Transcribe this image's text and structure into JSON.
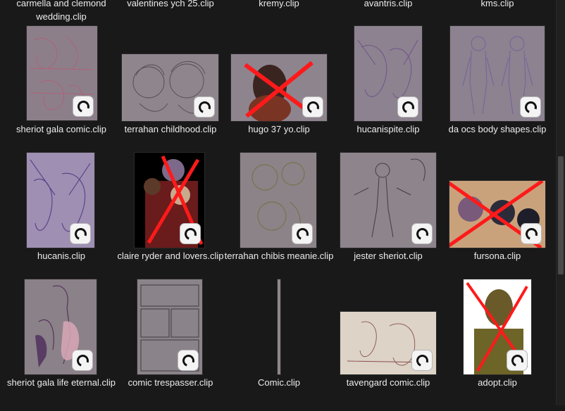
{
  "top_row_labels": [
    "carmella and clemond wedding.clip",
    "valentines ych 25.clip",
    "kremy.clip",
    "avantris.clip",
    "kms.clip"
  ],
  "files": [
    {
      "name": "sheriot gala comic.clip",
      "crossed": false
    },
    {
      "name": "terrahan childhood.clip",
      "crossed": false
    },
    {
      "name": "hugo 37 yo.clip",
      "crossed": true
    },
    {
      "name": "hucanispite.clip",
      "crossed": false
    },
    {
      "name": "da ocs body shapes.clip",
      "crossed": false
    },
    {
      "name": "hucanis.clip",
      "crossed": false
    },
    {
      "name": "claire ryder and lovers.clip",
      "crossed": true
    },
    {
      "name": "terrahan chibis meanie.clip",
      "crossed": false
    },
    {
      "name": "jester sheriot.clip",
      "crossed": false
    },
    {
      "name": "fursona.clip",
      "crossed": true
    },
    {
      "name": "sheriot gala life eternal.clip",
      "crossed": false
    },
    {
      "name": "comic trespasser.clip",
      "crossed": false
    },
    {
      "name": "Comic.clip",
      "crossed": false
    },
    {
      "name": "tavengard comic.clip",
      "crossed": false
    },
    {
      "name": "adopt.clip",
      "crossed": true
    }
  ],
  "colors": {
    "background": "#191919",
    "label_text": "#ececec",
    "cross_red": "#ff1a1a",
    "sketch_bg": "#8a7f8c"
  },
  "icons": {
    "file_badge": "clip-studio-icon"
  }
}
